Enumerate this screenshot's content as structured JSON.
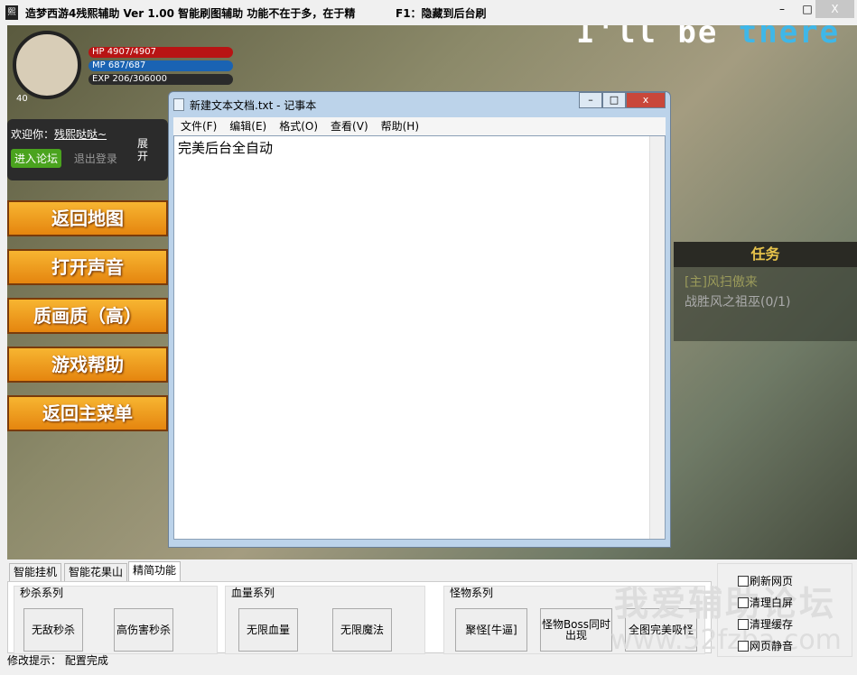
{
  "app": {
    "title": "造梦西游4残熙辅助 Ver 1.00 智能刷图辅助  功能不在于多，在于精",
    "hotkey": "F1：隐藏到后台刷",
    "logo": "熙",
    "min": "–",
    "max": "□",
    "close": "X"
  },
  "game": {
    "lyric_white": "I'll be ",
    "lyric_blue": "there ho",
    "hp": "HP    4907/4907",
    "mp": "MP    687/687",
    "exp": "EXP   206/306000",
    "level": "40",
    "welcome": "欢迎你：",
    "user": "残熙哒哒~",
    "forum": "进入论坛",
    "logout": "退出登录",
    "expand": "展开",
    "menu": [
      "返回地图",
      "打开声音",
      "质画质（高）",
      "游戏帮助",
      "返回主菜单"
    ],
    "task": {
      "title": "任务",
      "quest": "[主]风扫傲来",
      "goal": "战胜风之祖巫(0/1)"
    }
  },
  "notepad": {
    "title": "新建文本文档.txt - 记事本",
    "menu": [
      "文件(F)",
      "编辑(E)",
      "格式(O)",
      "查看(V)",
      "帮助(H)"
    ],
    "content": "完美后台全自动"
  },
  "tabs": [
    "智能挂机",
    "智能花果山",
    "精简功能"
  ],
  "groups": [
    {
      "label": "秒杀系列",
      "buttons": [
        "无敌秒杀",
        "高伤害秒杀"
      ]
    },
    {
      "label": "血量系列",
      "buttons": [
        "无限血量",
        "无限魔法"
      ]
    },
    {
      "label": "怪物系列",
      "buttons": [
        "聚怪[牛逼]",
        "怪物Boss同时出现",
        "全图完美吸怪"
      ]
    }
  ],
  "checks": [
    "刷新网页",
    "清理白屏",
    "清理缓存",
    "网页静音"
  ],
  "watermark": [
    "我爱辅助论坛",
    "www.52fzba.com"
  ],
  "status": {
    "label": "修改提示：",
    "value": "配置完成"
  }
}
